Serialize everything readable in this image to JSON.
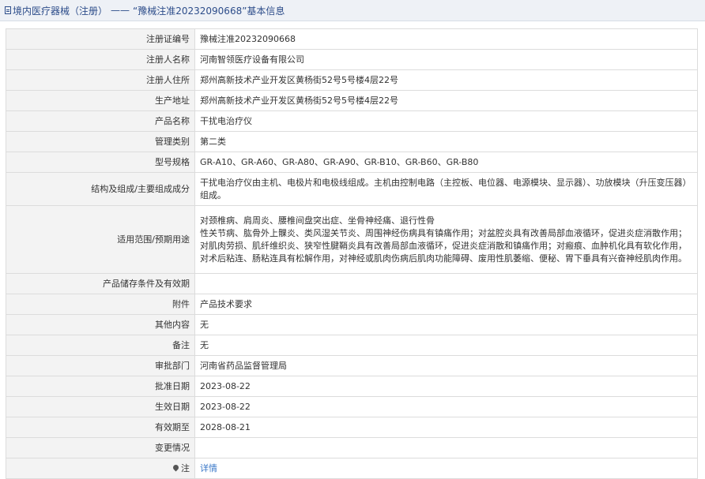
{
  "header": {
    "section": "境内医疗器械（注册）",
    "separator": "——",
    "subtitle": "“豫械注准20232090668”基本信息"
  },
  "rows": [
    {
      "label": "注册证编号",
      "value": "豫械注准20232090668"
    },
    {
      "label": "注册人名称",
      "value": "河南智领医疗设备有限公司"
    },
    {
      "label": "注册人住所",
      "value": "郑州高新技术产业开发区黄杨街52号5号楼4层22号"
    },
    {
      "label": "生产地址",
      "value": "郑州高新技术产业开发区黄杨街52号5号楼4层22号"
    },
    {
      "label": "产品名称",
      "value": "干扰电治疗仪"
    },
    {
      "label": "管理类别",
      "value": "第二类"
    },
    {
      "label": "型号规格",
      "value": "GR-A10、GR-A60、GR-A80、GR-A90、GR-B10、GR-B60、GR-B80"
    },
    {
      "label": "结构及组成/主要组成成分",
      "value": "干扰电治疗仪由主机、电极片和电极线组成。主机由控制电路（主控板、电位器、电源模块、显示器）、功放模块（升压变压器）组成。"
    },
    {
      "label": "适用范围/预期用途",
      "value_line1": "对颈椎病、肩周炎、腰椎间盘突出症、坐骨神经痛、退行性骨",
      "value_line2": "性关节病、肱骨外上髁炎、类风湿关节炎、周围神经伤病具有镇痛作用；对盆腔炎具有改善局部血液循环，促进炎症消散作用；对肌肉劳损、肌纤维织炎、狭窄性腱鞘炎具有改善局部血液循环，促进炎症消散和镇痛作用；对瘢痕、血肿机化具有软化作用，对术后粘连、肠粘连具有松解作用，对神经或肌肉伤病后肌肉功能障碍、废用性肌萎缩、便秘、胃下垂具有兴奋神经肌肉作用。"
    },
    {
      "label": "产品储存条件及有效期",
      "value": ""
    },
    {
      "label": "附件",
      "value": "产品技术要求"
    },
    {
      "label": "其他内容",
      "value": "无"
    },
    {
      "label": "备注",
      "value": "无"
    },
    {
      "label": "审批部门",
      "value": "河南省药品监督管理局"
    },
    {
      "label": "批准日期",
      "value": "2023-08-22"
    },
    {
      "label": "生效日期",
      "value": "2023-08-22"
    },
    {
      "label": "有效期至",
      "value": "2028-08-21"
    },
    {
      "label": "变更情况",
      "value": ""
    },
    {
      "label": "注",
      "value": "详情"
    }
  ]
}
